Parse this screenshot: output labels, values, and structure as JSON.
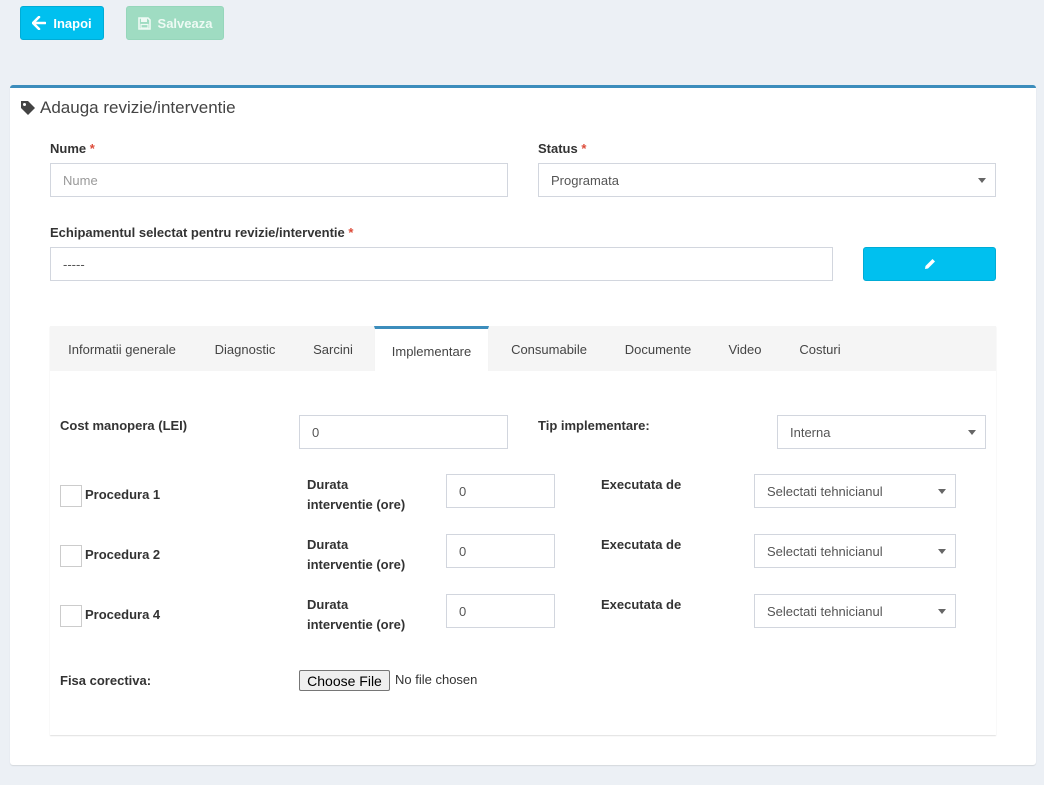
{
  "toolbar": {
    "back_label": "Inapoi",
    "save_label": "Salveaza"
  },
  "box": {
    "title": "Adauga revizie/interventie"
  },
  "form": {
    "nume_label": "Nume",
    "nume_placeholder": "Nume",
    "status_label": "Status",
    "status_value": "Programata",
    "equipment_label": "Echipamentul selectat pentru revizie/interventie",
    "equipment_value": "-----",
    "required_mark": "*"
  },
  "tabs": [
    {
      "label": "Informatii generale",
      "active": false
    },
    {
      "label": "Diagnostic",
      "active": false
    },
    {
      "label": "Sarcini",
      "active": false
    },
    {
      "label": "Implementare",
      "active": true
    },
    {
      "label": "Consumabile",
      "active": false
    },
    {
      "label": "Documente",
      "active": false
    },
    {
      "label": "Video",
      "active": false
    },
    {
      "label": "Costuri",
      "active": false
    }
  ],
  "implementare": {
    "cost_label": "Cost manopera (LEI)",
    "cost_value": "0",
    "tip_label": "Tip implementare:",
    "tip_value": "Interna",
    "durata_line1": "Durata",
    "durata_line2": "interventie (ore)",
    "executata_label": "Executata de",
    "technician_placeholder": "Selectati tehnicianul",
    "procedures": [
      {
        "name": "Procedura 1",
        "durata": "0"
      },
      {
        "name": "Procedura 2",
        "durata": "0"
      },
      {
        "name": "Procedura 4",
        "durata": "0"
      }
    ],
    "fisa_label": "Fisa corectiva:",
    "file_button": "Choose File",
    "file_status": "No file chosen"
  },
  "colors": {
    "accent": "#3c8dbc",
    "info": "#00c0ef",
    "success_disabled": "#9fdcc2",
    "required": "#dd4b39"
  },
  "icons": [
    "arrow-left-icon",
    "floppy-disk-icon",
    "tag-icon",
    "pencil-icon",
    "caret-down-icon"
  ]
}
